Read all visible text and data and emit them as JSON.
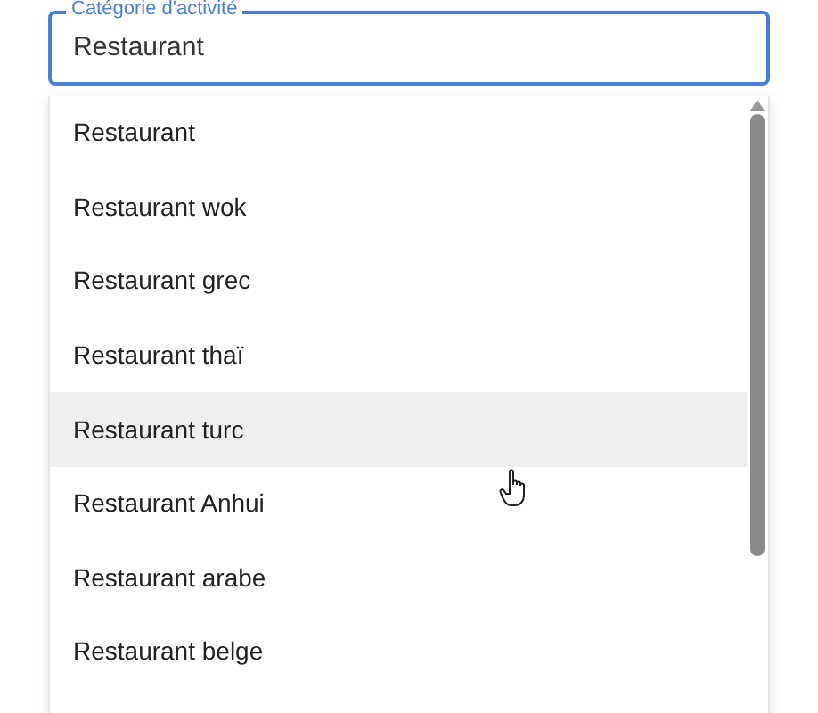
{
  "field": {
    "label": "Catégorie d'activité",
    "value": "Restaurant"
  },
  "options": [
    {
      "label": "Restaurant",
      "selected": false
    },
    {
      "label": "Restaurant wok",
      "selected": false
    },
    {
      "label": "Restaurant grec",
      "selected": false
    },
    {
      "label": "Restaurant thaï",
      "selected": false
    },
    {
      "label": "Restaurant turc",
      "selected": true
    },
    {
      "label": "Restaurant Anhui",
      "selected": false
    },
    {
      "label": "Restaurant arabe",
      "selected": false
    },
    {
      "label": "Restaurant belge",
      "selected": false
    }
  ]
}
